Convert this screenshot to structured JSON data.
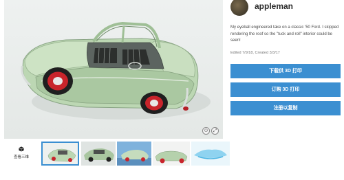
{
  "author": {
    "name": "appleman"
  },
  "description": "My eyeball engineered take on a classic '50 Ford. I skipped rendering the roof so the \"tuck and roll\" interior could be seen!",
  "meta": "Edited 7/9/18, Created 3/3/17",
  "actions": {
    "download": "下载供 3D 打印",
    "order": "订购 3D 打印",
    "register": "注册以复制"
  },
  "viewer": {
    "controls": [
      "zoom-reset-icon",
      "fullscreen-icon"
    ]
  },
  "thumbnails": {
    "view_3d_label": "查看三维",
    "items": [
      {
        "name": "thumb-1",
        "active": true
      },
      {
        "name": "thumb-2",
        "active": false
      },
      {
        "name": "thumb-3",
        "active": false
      },
      {
        "name": "thumb-4",
        "active": false
      },
      {
        "name": "thumb-5",
        "active": false
      }
    ]
  },
  "colors": {
    "accent": "#3b8fd1",
    "car_body": "#bcd7b3",
    "wheel_red": "#c8242b"
  }
}
